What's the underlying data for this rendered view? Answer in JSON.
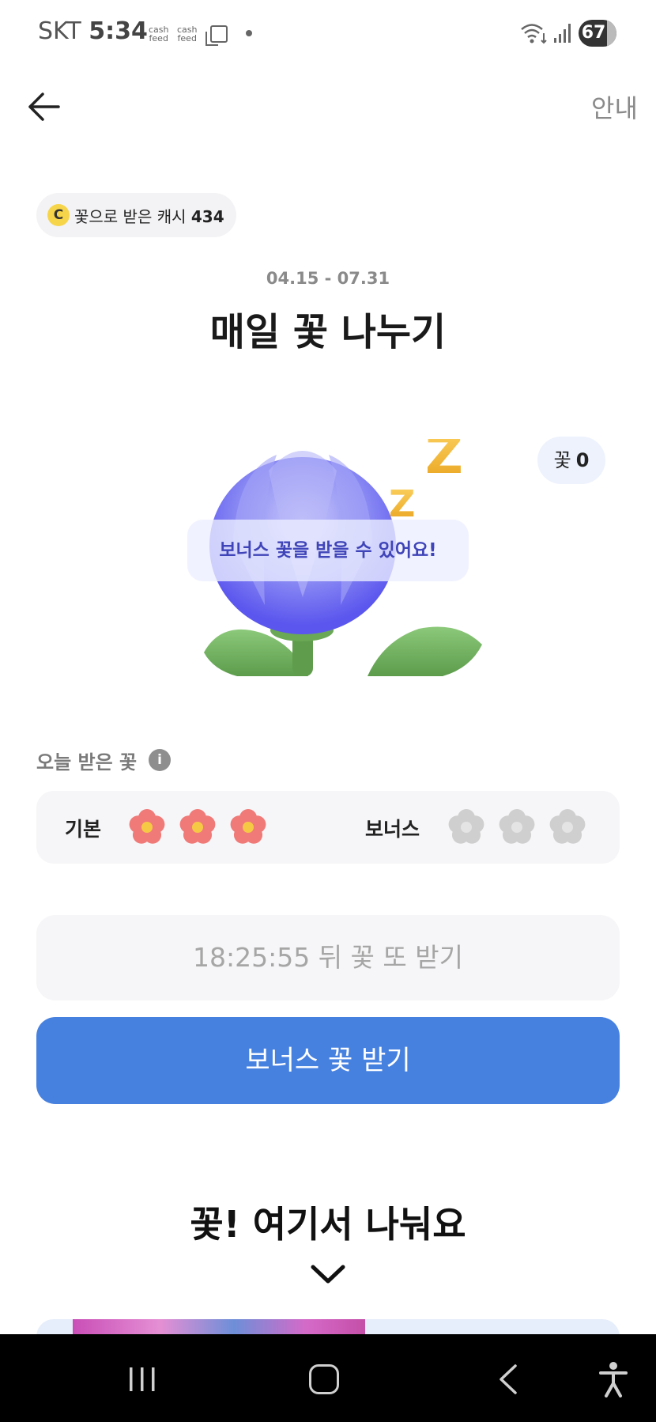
{
  "status_bar": {
    "carrier": "SKT",
    "time": "5:34",
    "notification_1": "cash\nfeed",
    "notification_2": "cash\nfeed",
    "battery": "67"
  },
  "header": {
    "back_icon": "arrow-left-icon",
    "guide_label": "안내"
  },
  "cash_chip": {
    "coin_letter": "C",
    "label": "꽃으로 받은 캐시",
    "amount": "434"
  },
  "event": {
    "period": "04.15 - 07.31",
    "title": "매일 꽃 나누기"
  },
  "flower_count": {
    "label": "꽃",
    "value": "0"
  },
  "illustration": {
    "bubble_text": "보너스 꽃을 받을 수 있어요!",
    "colors": {
      "petal": "#7f7ef2",
      "leaf": "#6fae5a",
      "zzz": "#f0b42c"
    }
  },
  "today": {
    "label": "오늘 받은 꽃",
    "info_icon": "info-icon",
    "basic_label": "기본",
    "basic_collected": 3,
    "basic_total": 3,
    "bonus_label": "보너스",
    "bonus_collected": 0,
    "bonus_total": 3,
    "colors": {
      "collected": "#f07a78",
      "empty": "#cfcfcf"
    }
  },
  "timer_text": "18:25:55 뒤 꽃 또 받기",
  "cta_label": "보너스 꽃 받기",
  "share": {
    "title": "꽃! 여기서 나눠요",
    "icon": "chevron-down-icon"
  },
  "nav": {
    "recent_icon": "recent-apps-icon",
    "home_icon": "home-icon",
    "back_icon": "back-icon",
    "accessibility_icon": "accessibility-icon"
  },
  "colors": {
    "accent": "#4781e0",
    "bubble_text": "#3f44b8",
    "chip_bg": "#f3f3f5"
  }
}
